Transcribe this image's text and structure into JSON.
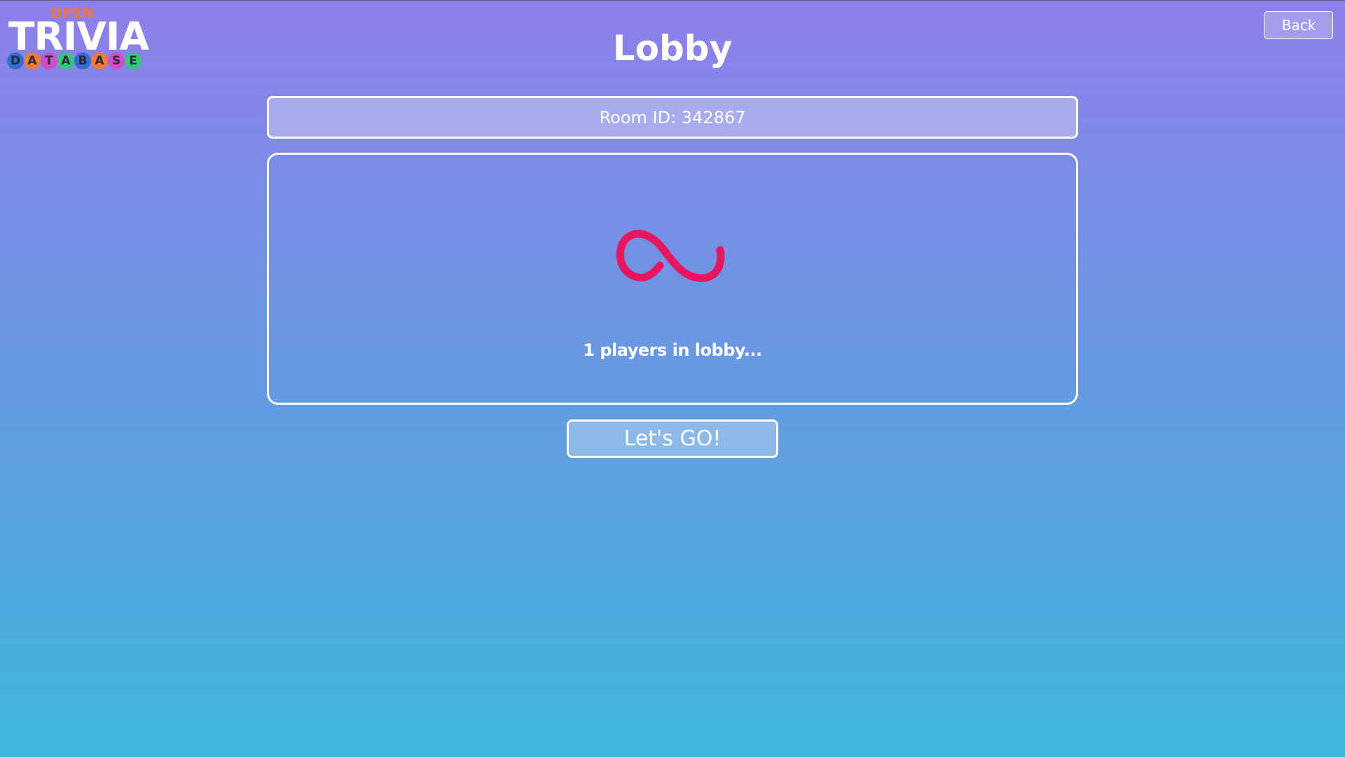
{
  "logo": {
    "open": "OPEN",
    "trivia": "TRIVIA",
    "database_letters": [
      {
        "letter": "D",
        "color": "#2f6fd1"
      },
      {
        "letter": "A",
        "color": "#f07a36"
      },
      {
        "letter": "T",
        "color": "#d24cc8"
      },
      {
        "letter": "A",
        "color": "#34c97a"
      },
      {
        "letter": "B",
        "color": "#2f6fd1"
      },
      {
        "letter": "A",
        "color": "#f07a36"
      },
      {
        "letter": "S",
        "color": "#d24cc8"
      },
      {
        "letter": "E",
        "color": "#34c97a"
      }
    ]
  },
  "header": {
    "back_label": "Back",
    "title": "Lobby"
  },
  "room": {
    "label": "Room ID: 342867"
  },
  "lobby": {
    "loader_icon": "infinity-loader-icon",
    "loader_color": "#e8165e",
    "status": "1 players in lobby..."
  },
  "actions": {
    "go_label": "Let's GO!"
  }
}
